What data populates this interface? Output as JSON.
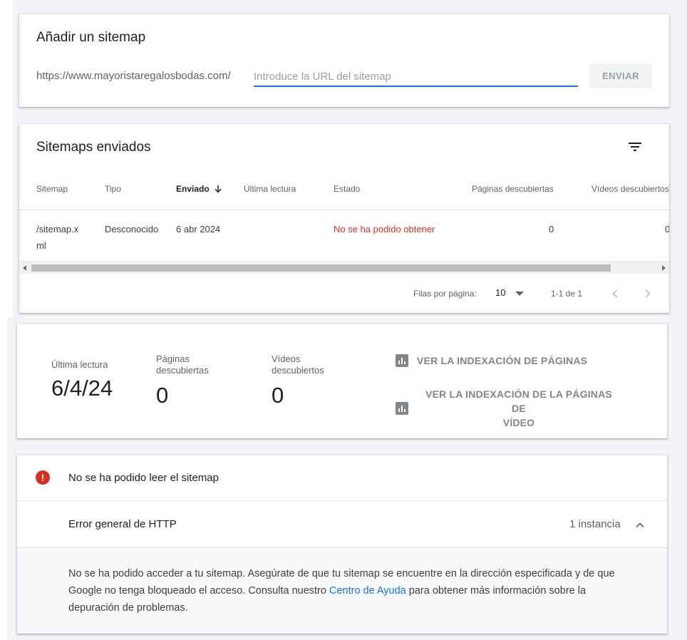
{
  "add_sitemap": {
    "title": "Añadir un sitemap",
    "url_prefix": "https://www.mayoristaregalosbodas.com/",
    "input_value": "",
    "input_placeholder": "Introduce la URL del sitemap",
    "send_label": "ENVIAR"
  },
  "submitted": {
    "title": "Sitemaps enviados",
    "filter_icon": "filter-icon",
    "columns": [
      "Sitemap",
      "Tipo",
      "Enviado",
      "Última lectura",
      "Estado",
      "Páginas descubiertas",
      "Vídeos descubiertos"
    ],
    "sorted_column": "Enviado",
    "rows": [
      {
        "sitemap_line1": "/sitemap.x",
        "sitemap_line2": "ml",
        "type": "Desconocido",
        "submitted": "6 abr 2024",
        "last_read": "",
        "status": "No se ha podido obtener",
        "pages": "0",
        "videos": "0"
      }
    ],
    "pager": {
      "rows_per_page_label": "Filas por página:",
      "rows_per_page": "10",
      "range": "1-1 de 1"
    }
  },
  "stats": {
    "last_read_label": "Última lectura",
    "last_read_value": "6/4/24",
    "pages_label_1": "Páginas",
    "pages_label_2": "descubiertas",
    "pages_value": "0",
    "videos_label_1": "Vídeos",
    "videos_label_2": "descubiertos",
    "videos_value": "0",
    "action_pages": "VER LA INDEXACIÓN DE PÁGINAS",
    "action_videos_1": "VER LA INDEXACIÓN DE LA PÁGINAS DE",
    "action_videos_2": "VÍDEO"
  },
  "error": {
    "title": "No se ha podido leer el sitemap",
    "sub_label": "Error general de HTTP",
    "sub_count": "1 instancia",
    "desc_before": "No se ha podido acceder a tu sitemap. Asegúrate de que tu sitemap se encuentre en la dirección especificada y de que Google no tenga bloqueado el acceso. Consulta nuestro ",
    "desc_link": "Centro de Ayuda",
    "desc_after": " para obtener más información sobre la depuración de problemas."
  },
  "colors": {
    "accent": "#1a73e8",
    "error": "#d93025"
  }
}
